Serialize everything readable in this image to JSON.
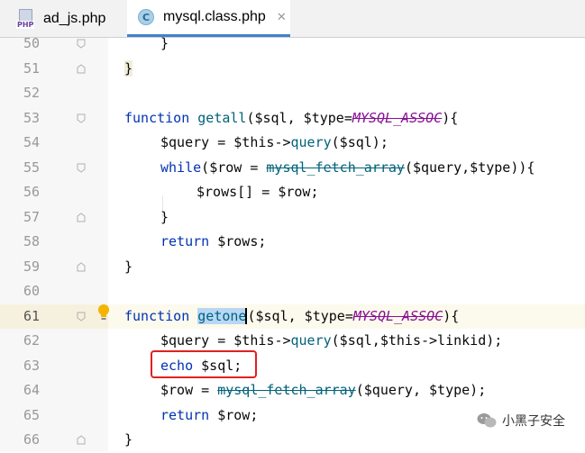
{
  "tabs": [
    {
      "label": "ad_js.php",
      "icon": "php-file-icon",
      "icon_text": "PHP",
      "active": false
    },
    {
      "label": "mysql.class.php",
      "icon": "class-icon",
      "icon_text": "C",
      "active": true
    }
  ],
  "editor": {
    "current_line": 61,
    "lines": [
      {
        "n": "50"
      },
      {
        "n": "51"
      },
      {
        "n": "52"
      },
      {
        "n": "53"
      },
      {
        "n": "54"
      },
      {
        "n": "55"
      },
      {
        "n": "56"
      },
      {
        "n": "57"
      },
      {
        "n": "58"
      },
      {
        "n": "59"
      },
      {
        "n": "60"
      },
      {
        "n": "61"
      },
      {
        "n": "62"
      },
      {
        "n": "63"
      },
      {
        "n": "64"
      },
      {
        "n": "65"
      },
      {
        "n": "66"
      }
    ]
  },
  "code": {
    "l50": "}",
    "l51": "}",
    "l53": {
      "kw": "function",
      "name": "getall",
      "p1": "($sql, $type=",
      "const": "MYSQL_ASSOC",
      "p2": "){"
    },
    "l54": {
      "v": "$query",
      "eq": " = ",
      "this": "$this",
      "arrow": "->",
      "call": "query",
      "rest": "($sql);"
    },
    "l55": {
      "kw": "while",
      "open": "(",
      "v": "$row",
      "eq": " = ",
      "fn": "mysql_fetch_array",
      "rest": "($query,$type)){"
    },
    "l56": {
      "v": "$rows[]",
      "eq": " = ",
      "v2": "$row",
      "end": ";"
    },
    "l57": "}",
    "l58": {
      "kw": "return",
      "v": " $rows",
      "end": ";"
    },
    "l59": "}",
    "l61": {
      "kw": "function",
      "name": "getone",
      "p1": "($sql, $type=",
      "const": "MYSQL_ASSOC",
      "p2": "){"
    },
    "l62": {
      "v": "$query",
      "eq": " = ",
      "this": "$this",
      "arrow": "->",
      "call": "query",
      "rest1": "($sql,",
      "this2": "$this",
      "rest2": "->linkid);"
    },
    "l63": {
      "kw": "echo",
      "rest": " $sql;"
    },
    "l64": {
      "v": "$row",
      "eq": " = ",
      "fn": "mysql_fetch_array",
      "rest": "($query, $type);"
    },
    "l65": {
      "kw": "return",
      "v": " $row",
      "end": ";"
    },
    "l66": "}"
  },
  "watermark": {
    "text": "小黑子安全"
  },
  "colors": {
    "keyword": "#0033b3",
    "variable": "#871094",
    "function": "#00627a",
    "highlight_box": "#e02020",
    "tab_underline": "#4083c9"
  }
}
